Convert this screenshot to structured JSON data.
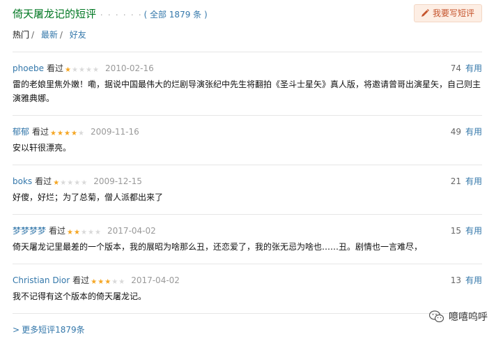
{
  "header": {
    "title": "倚天屠龙记的短评",
    "dots": "· · · · · ·",
    "total_prefix": "( 全部 ",
    "total_count": "1879",
    "total_suffix": " 条 )",
    "write_button": "我要写短评"
  },
  "tabs": [
    {
      "label": "热门",
      "sep": "/"
    },
    {
      "label": "最新",
      "sep": "/"
    },
    {
      "label": "好友",
      "sep": ""
    }
  ],
  "reviews": [
    {
      "user": "phoebe",
      "watched": "看过",
      "rating": 1,
      "date": "2010-02-16",
      "votes": "74",
      "useful_label": "有用",
      "content": "雷的老娘里焦外嫩！嘞，据说中国最伟大的烂剧导演张纪中先生将翻拍《圣斗士星矢》真人版，将邀请曾哥出演星矢，自己则主演雅典娜。"
    },
    {
      "user": "郁郁",
      "watched": "看过",
      "rating": 4,
      "date": "2009-11-16",
      "votes": "49",
      "useful_label": "有用",
      "content": "安以轩很漂亮。"
    },
    {
      "user": "boks",
      "watched": "看过",
      "rating": 1,
      "date": "2009-12-15",
      "votes": "21",
      "useful_label": "有用",
      "content": "好傻，好烂；为了总菊，僧人派都出来了"
    },
    {
      "user": "梦梦梦梦",
      "watched": "看过",
      "rating": 2,
      "date": "2017-04-02",
      "votes": "15",
      "useful_label": "有用",
      "content": "倚天屠龙记里最差的一个版本，我的展昭为啥那么丑，还恋爱了，我的张无忌为啥也……丑。剧情也一言难尽，"
    },
    {
      "user": "Christian Dior",
      "watched": "看过",
      "rating": 3,
      "date": "2017-04-02",
      "votes": "13",
      "useful_label": "有用",
      "content": "我不记得有这个版本的倚天屠龙记。"
    }
  ],
  "more": {
    "chevron": ">",
    "label": "更多短评1879条"
  },
  "watermark": {
    "text": "噫嘻呜呼"
  },
  "colors": {
    "link": "#3377aa",
    "title": "#007722",
    "star": "#f5a623",
    "button_bg": "#fdeee4",
    "button_text": "#c5542d"
  }
}
